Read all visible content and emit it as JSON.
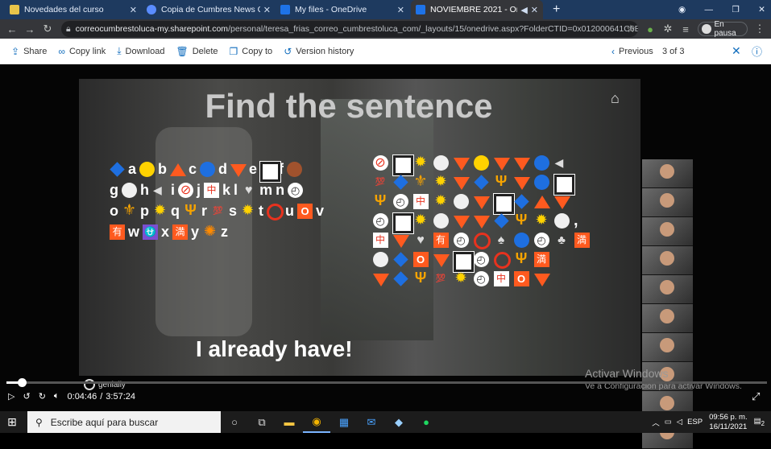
{
  "browser": {
    "tabs": [
      {
        "title": "Novedades del curso",
        "active": false,
        "favicon_color": "#e7c44a"
      },
      {
        "title": "Copia de Cumbres News CIST oc",
        "active": false,
        "favicon_color": "#5a8cff"
      },
      {
        "title": "My files - OneDrive",
        "active": false,
        "favicon_color": "#1e73e8"
      },
      {
        "title": "NOVIEMBRE 2021 - OneDriv",
        "active": true,
        "favicon_color": "#1e73e8"
      }
    ],
    "new_tab": "+",
    "url_domain": "correocumbrestoluca-my.sharepoint.com",
    "url_path": "/personal/teresa_frias_correo_cumbrestoluca_com/_layouts/15/onedrive.aspx?FolderCTID=0x012000641C6EE2D...",
    "profile_status": "En pausa"
  },
  "toolbar": {
    "share": "Share",
    "copy_link": "Copy link",
    "download": "Download",
    "delete": "Delete",
    "copy_to": "Copy to",
    "version_history": "Version history",
    "previous": "Previous",
    "counter": "3 of 3"
  },
  "slide": {
    "title": "Find the sentence",
    "answer": "I already have!",
    "key_rows": [
      [
        [
          "diamond",
          "a"
        ],
        [
          "ycirc",
          "b"
        ],
        [
          "rtri",
          "c"
        ],
        [
          "bcirc",
          "d"
        ],
        [
          "dtri",
          "e"
        ],
        [
          "wsq",
          "f"
        ],
        [
          "brcirc",
          ""
        ]
      ],
      [
        [
          "",
          "g"
        ],
        [
          "wcirc",
          "h"
        ],
        [
          "spk",
          "i"
        ],
        [
          "nochk",
          "j"
        ],
        [
          "ideo",
          "k"
        ],
        [
          "",
          "l"
        ],
        [
          "heart",
          "m"
        ],
        [
          "",
          "n"
        ],
        [
          "clock",
          ""
        ]
      ],
      [
        [
          "",
          "o"
        ],
        [
          "fleur",
          "p"
        ],
        [
          "sun",
          "q"
        ],
        [
          "trid",
          "r"
        ],
        [
          "hund",
          "s"
        ],
        [
          "sun",
          "t"
        ],
        [
          "rring",
          "u"
        ],
        [
          "osq",
          "v"
        ]
      ],
      [
        [
          "you",
          "w"
        ],
        [
          "ophi",
          "x"
        ],
        [
          "man",
          "y"
        ],
        [
          "burst",
          "z"
        ]
      ]
    ],
    "puzzle_rows": [
      [
        "nochk",
        "wsq",
        "sun",
        "wcirc",
        "dtri",
        "ycirc",
        "dtri",
        "dtri",
        "bcirc",
        "spk"
      ],
      [
        "hund",
        "diamond",
        "fleur",
        "sun",
        "dtri",
        "diamond",
        "trid",
        "dtri",
        "bcirc",
        "wsq"
      ],
      [
        "trid",
        "clock",
        "ideo",
        "sun",
        "wcirc",
        "dtri",
        "wsq",
        "diamond",
        "rtri",
        "dtri"
      ],
      [
        "clock",
        "wsq",
        "sun",
        "wcirc",
        "dtri",
        "dtri",
        "diamond",
        "trid",
        "sun",
        "wcirc"
      ],
      [
        "ideo",
        "dtri",
        "heart",
        "you",
        "clock",
        "rring",
        "spade",
        "bcirc",
        "clock",
        "club",
        "man"
      ],
      [
        "wcirc",
        "diamond",
        "osq",
        "dtri",
        "wsq",
        "clock",
        "rring",
        "trid",
        "man"
      ],
      [
        "dtri",
        "diamond",
        "trid",
        "hund",
        "sun",
        "clock",
        "ideo",
        "osq",
        "dtri"
      ]
    ],
    "comma": ","
  },
  "player": {
    "current_time": "0:04:46",
    "separator": "/",
    "duration": "3:57:24",
    "progress": 0.02,
    "watermark": "genially"
  },
  "activate_windows": {
    "line1": "Activar Windows",
    "line2": "Ve a Configuración para activar Windows."
  },
  "taskbar": {
    "search_placeholder": "Escribe aquí para buscar",
    "language": "ESP",
    "time": "09:56 p. m.",
    "date": "16/11/2021",
    "notifications": "2"
  }
}
